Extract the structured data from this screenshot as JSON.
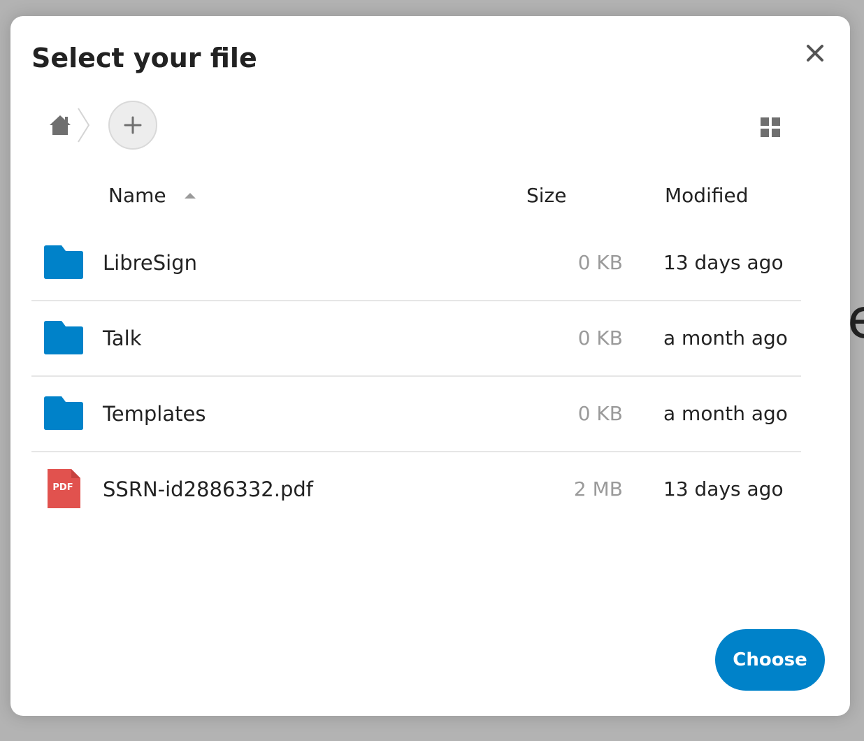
{
  "backdrop": {
    "glyph": "e"
  },
  "dialog": {
    "title": "Select your file",
    "close_icon": "close-icon"
  },
  "toolbar": {
    "home_icon": "home-icon",
    "add_icon": "plus-icon",
    "view_toggle_icon": "grid-view-icon"
  },
  "columns": {
    "name": "Name",
    "size": "Size",
    "modified": "Modified"
  },
  "files": [
    {
      "name": "LibreSign",
      "type": "folder",
      "size": "0 KB",
      "modified": "13 days ago"
    },
    {
      "name": "Talk",
      "type": "folder",
      "size": "0 KB",
      "modified": "a month ago"
    },
    {
      "name": "Templates",
      "type": "folder",
      "size": "0 KB",
      "modified": "a month ago"
    },
    {
      "name": "SSRN-id2886332.pdf",
      "type": "pdf",
      "size": "2 MB",
      "modified": "13 days ago",
      "badge": "PDF"
    }
  ],
  "actions": {
    "choose_label": "Choose"
  },
  "colors": {
    "primary": "#0082c9",
    "folder": "#0082c9",
    "pdf": "#e1524e",
    "text": "#222222",
    "muted": "#9a9a9a"
  }
}
